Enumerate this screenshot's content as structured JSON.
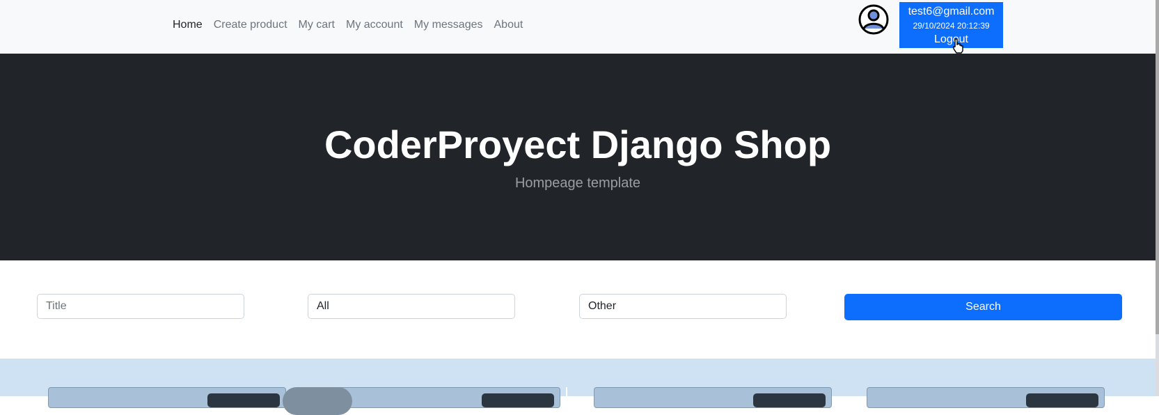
{
  "nav": {
    "links": [
      {
        "label": "Home",
        "active": true
      },
      {
        "label": "Create product",
        "active": false
      },
      {
        "label": "My cart",
        "active": false
      },
      {
        "label": "My account",
        "active": false
      },
      {
        "label": "My messages",
        "active": false
      },
      {
        "label": "About",
        "active": false
      }
    ],
    "avatar_icon": "user-circle-icon",
    "user": {
      "email": "test6@gmail.com",
      "timestamp": "29/10/2024 20:12:39",
      "logout_label": "Logout"
    }
  },
  "hero": {
    "title": "CoderProyect Django Shop",
    "subtitle": "Hompeage template"
  },
  "search": {
    "title_placeholder": "Title",
    "category_value": "All",
    "condition_value": "Other",
    "button_label": "Search"
  },
  "colors": {
    "primary": "#0d6efd",
    "hero_bg": "#212529",
    "nav_bg": "#f8f9fa",
    "products_bg": "#cfe2f3"
  }
}
